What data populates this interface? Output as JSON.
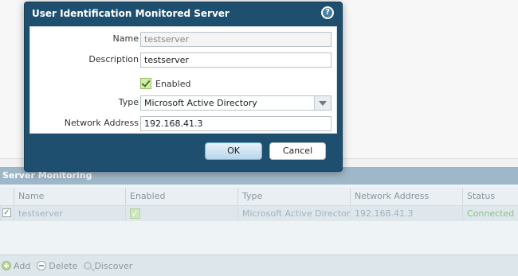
{
  "dialog": {
    "title": "User Identification Monitored Server",
    "help_glyph": "?",
    "fields": {
      "name_label": "Name",
      "name_value": "testserver",
      "description_label": "Description",
      "description_value": "testserver",
      "enabled_label": "Enabled",
      "enabled_checked": true,
      "type_label": "Type",
      "type_value": "Microsoft Active Directory",
      "network_address_label": "Network Address",
      "network_address_value": "192.168.41.3"
    },
    "ok_label": "OK",
    "cancel_label": "Cancel"
  },
  "server_monitoring": {
    "title": "Server Monitoring",
    "columns": [
      "Name",
      "Enabled",
      "Type",
      "Network Address",
      "Status"
    ],
    "rows": [
      {
        "name": "testserver",
        "enabled": true,
        "type": "Microsoft Active Directory",
        "network_address": "192.168.41.3",
        "status": "Connected"
      }
    ],
    "footer": {
      "add_label": "Add",
      "delete_label": "Delete",
      "discover_label": "Discover"
    }
  },
  "colors": {
    "dialog_background": "#1f4f6e",
    "section_header": "#9fb8c9",
    "status_connected": "#8cc28a",
    "ok_button_border": "#7aaed1"
  }
}
